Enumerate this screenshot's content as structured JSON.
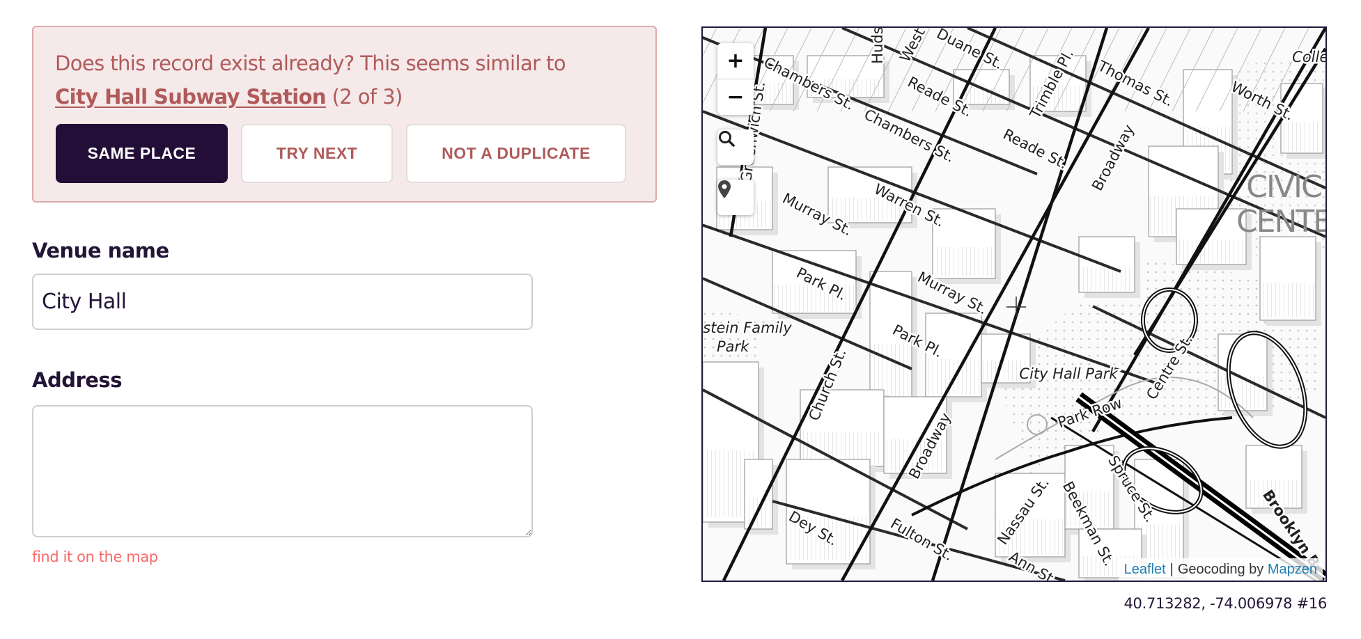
{
  "duplicate_alert": {
    "message": "Does this record exist already? This seems similar to",
    "match_name": "City Hall Subway Station",
    "match_counter": "(2 of 3)",
    "buttons": {
      "same_place": "SAME PLACE",
      "try_next": "TRY NEXT",
      "not_duplicate": "NOT A DUPLICATE"
    }
  },
  "form": {
    "venue_name": {
      "label": "Venue name",
      "value": "City Hall"
    },
    "address": {
      "label": "Address",
      "value": ""
    },
    "find_on_map_link": "find it on the map"
  },
  "map": {
    "controls": {
      "zoom_in": "+",
      "zoom_out": "−",
      "search_icon": "search-icon",
      "locate_icon": "map-marker-icon"
    },
    "attribution": {
      "leaflet": "Leaflet",
      "separator": "|",
      "geocoding_prefix": "Geocoding by",
      "mapzen": "Mapzen"
    },
    "coordinates_readout": "40.713282, -74.006978 #16",
    "labels": {
      "streets": [
        "Chambers St.",
        "Chambers St.",
        "Duane St.",
        "Reade St.",
        "Reade St.",
        "Thomas St.",
        "Worth St.",
        "Trimble Pl.",
        "Broadway",
        "Warren St.",
        "Murray St.",
        "Murray St.",
        "Park Pl.",
        "Park Pl.",
        "Church St.",
        "Park Row",
        "Centre St.",
        "Broadway",
        "Spruce St.",
        "Nassau St.",
        "Beekman St.",
        "Dey St.",
        "Fulton St.",
        "Ann St",
        "Brooklyn B",
        "Huds",
        "West",
        "Greenwich St."
      ],
      "parks": [
        "City Hall Park",
        "stein Family",
        "Park",
        "Collec"
      ],
      "districts": [
        "CIVIC",
        "CENTE"
      ]
    },
    "colors": {
      "border": "#241a3a",
      "link": "#1e7fb5"
    }
  },
  "colors": {
    "alert_background": "#f5e9ea",
    "alert_text": "#b05a5a",
    "primary_button": "#220e36",
    "find_link": "#f76b6b"
  }
}
